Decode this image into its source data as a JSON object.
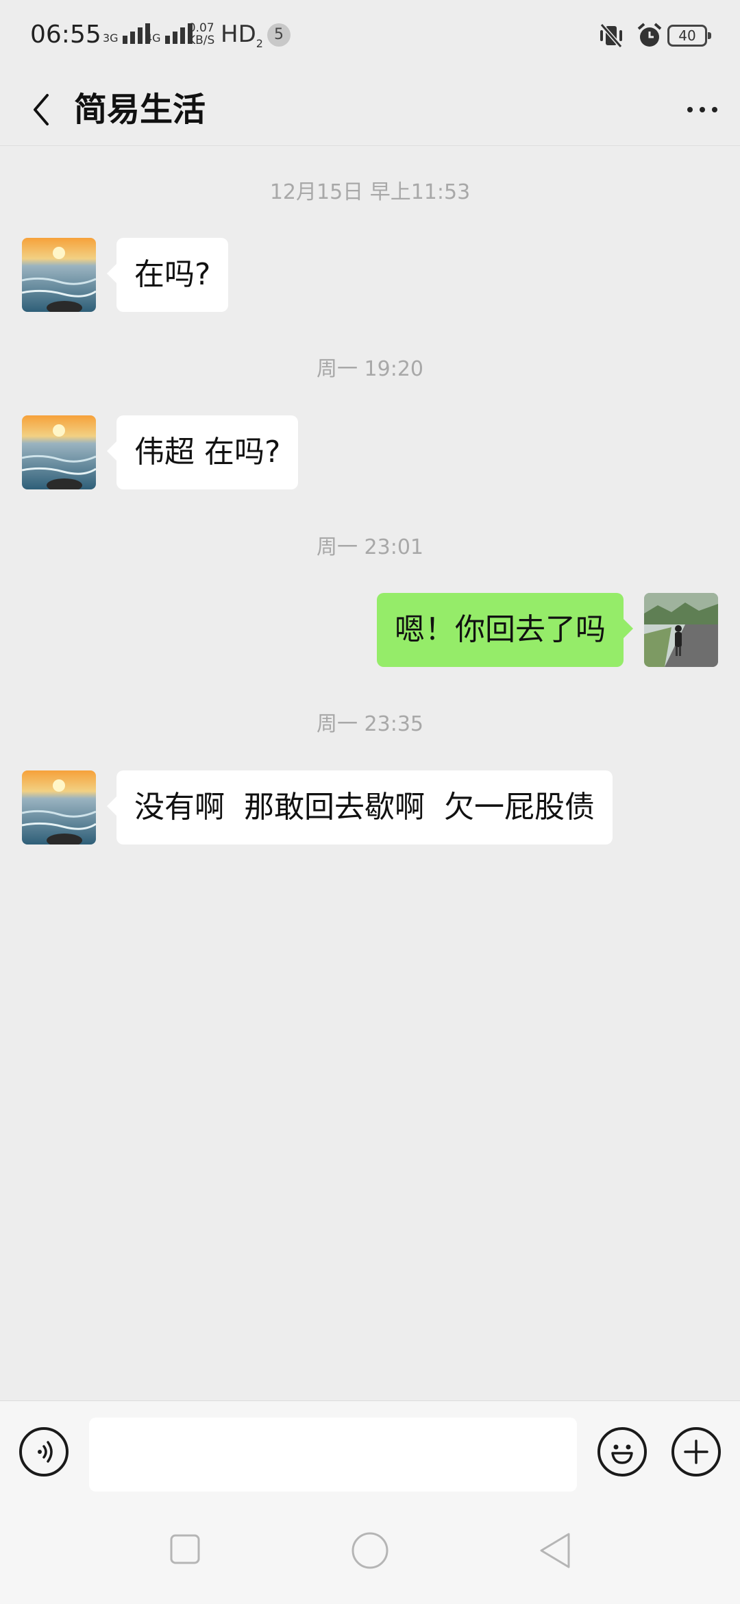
{
  "status_bar": {
    "time": "06:55",
    "net1": "3G",
    "net2": "4G",
    "speed_value": "0.07",
    "speed_unit": "KB/S",
    "hd": "HD",
    "hd_sub": "2",
    "notification_count": "5",
    "battery": "40"
  },
  "nav": {
    "title": "简易生活"
  },
  "messages": [
    {
      "timestamp": "12月15日 早上11:53",
      "side": "left",
      "text": "在吗?"
    },
    {
      "timestamp": "周一 19:20",
      "side": "left",
      "text": "伟超 在吗?"
    },
    {
      "timestamp": "周一 23:01",
      "side": "right",
      "text": "嗯！你回去了吗"
    },
    {
      "timestamp": "周一 23:35",
      "side": "left",
      "text": "没有啊  那敢回去歇啊  欠一屁股债"
    }
  ],
  "input": {
    "value": "",
    "placeholder": ""
  },
  "icons": {
    "back": "chevron-left-icon",
    "more": "more-dots-icon",
    "voice": "voice-icon",
    "emoji": "emoji-icon",
    "plus": "plus-icon",
    "mute": "vibrate-off-icon",
    "alarm": "alarm-icon"
  },
  "colors": {
    "background": "#ededed",
    "bubble_mine": "#95ec69",
    "bubble_other": "#ffffff",
    "timestamp": "#a8a8a8"
  }
}
